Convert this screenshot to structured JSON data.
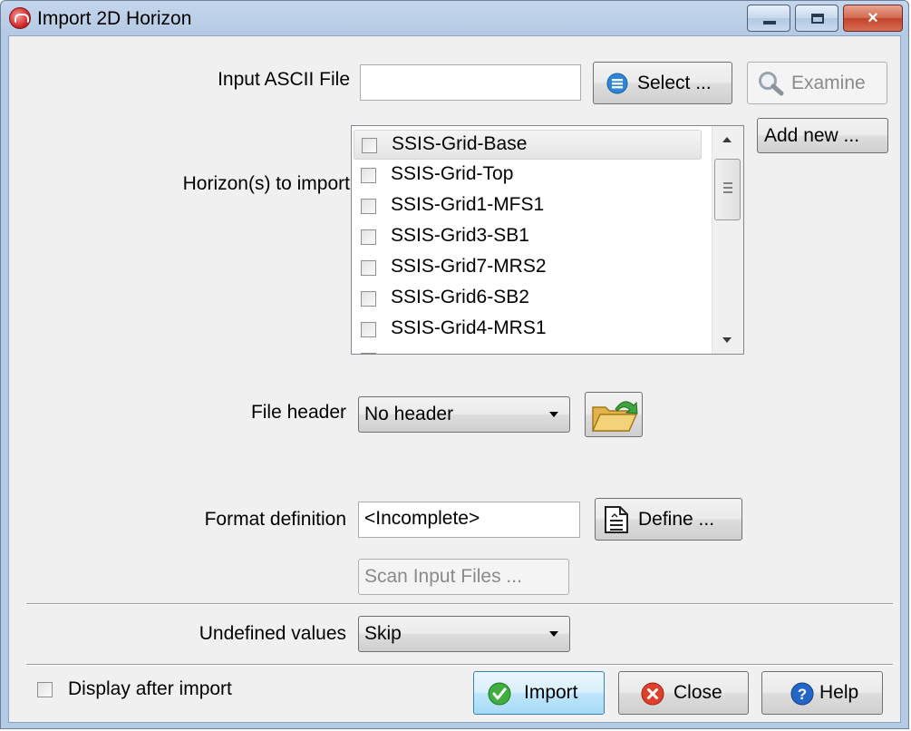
{
  "window": {
    "title": "Import 2D Horizon",
    "icon": "app-logo-icon",
    "controls": {
      "minimize": "minimize-icon",
      "maximize": "maximize-icon",
      "close": "×"
    }
  },
  "input_file": {
    "label": "Input ASCII File",
    "value": "",
    "select_label": "Select ...",
    "examine_label": "Examine",
    "add_new_label": "Add new ..."
  },
  "horizons": {
    "label": "Horizon(s) to import",
    "items": [
      {
        "name": "SSIS-Grid-Base",
        "checked": false,
        "selected": true
      },
      {
        "name": "SSIS-Grid-Top",
        "checked": false,
        "selected": false
      },
      {
        "name": "SSIS-Grid1-MFS1",
        "checked": false,
        "selected": false
      },
      {
        "name": "SSIS-Grid3-SB1",
        "checked": false,
        "selected": false
      },
      {
        "name": "SSIS-Grid7-MRS2",
        "checked": false,
        "selected": false
      },
      {
        "name": "SSIS-Grid6-SB2",
        "checked": false,
        "selected": false
      },
      {
        "name": "SSIS-Grid4-MRS1",
        "checked": false,
        "selected": false
      }
    ]
  },
  "file_header": {
    "label": "File header",
    "value": "No header"
  },
  "format": {
    "label": "Format definition",
    "value": "<Incomplete>",
    "define_label": "Define ..."
  },
  "scan_label": "Scan Input Files ...",
  "undefined_values": {
    "label": "Undefined values",
    "value": "Skip"
  },
  "footer": {
    "display_after_import": "Display after import",
    "import_label": "Import",
    "close_label": "Close",
    "help_label": "Help"
  },
  "colors": {
    "accent_blue": "#2f86d8",
    "success_green": "#3fae3f",
    "danger_red": "#e0402a",
    "help_blue": "#2466c7"
  }
}
